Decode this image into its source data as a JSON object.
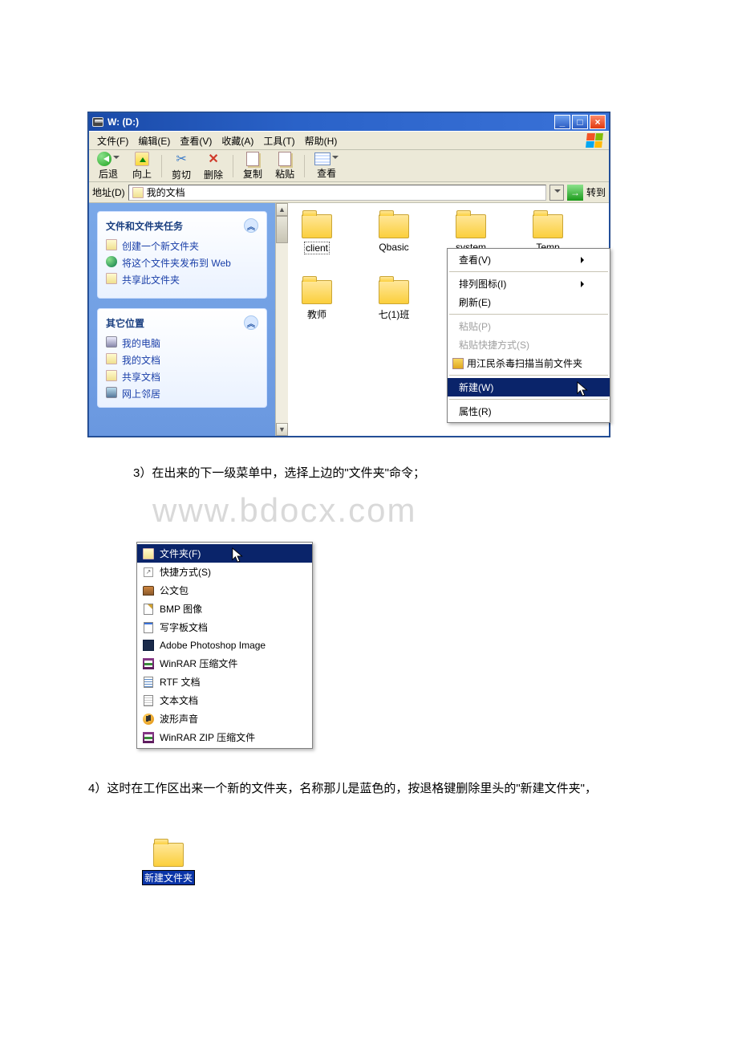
{
  "watermark": "www.bdocx.com",
  "window": {
    "title": "W: (D:)",
    "btn_min": "_",
    "btn_max": "□",
    "btn_close": "×"
  },
  "menubar": {
    "file": "文件(F)",
    "edit": "编辑(E)",
    "view": "查看(V)",
    "fav": "收藏(A)",
    "tools": "工具(T)",
    "help": "帮助(H)"
  },
  "toolbar": {
    "back": "后退",
    "up": "向上",
    "cut": "剪切",
    "del": "删除",
    "copy": "复制",
    "paste": "粘贴",
    "views": "查看"
  },
  "addressbar": {
    "label": "地址(D)",
    "value": "我的文档",
    "go": "转到"
  },
  "sidebar": {
    "tasks": {
      "title": "文件和文件夹任务",
      "items": [
        "创建一个新文件夹",
        "将这个文件夹发布到 Web",
        "共享此文件夹"
      ]
    },
    "other": {
      "title": "其它位置",
      "items": [
        "我的电脑",
        "我的文档",
        "共享文档",
        "网上邻居"
      ]
    }
  },
  "files": [
    "client",
    "Qbasic",
    "system",
    "Temp",
    "教师",
    "七(1)班"
  ],
  "contextmenu": {
    "view": "查看(V)",
    "arrange": "排列图标(I)",
    "refresh": "刷新(E)",
    "paste": "粘贴(P)",
    "paste_shortcut": "粘贴快捷方式(S)",
    "antivirus": "用江民杀毒扫描当前文件夹",
    "new": "新建(W)",
    "properties": "属性(R)"
  },
  "step3": "3）在出来的下一级菜单中，选择上边的\"文件夹\"命令；",
  "submenu": {
    "folder": "文件夹(F)",
    "shortcut": "快捷方式(S)",
    "briefcase": "公文包",
    "bmp": "BMP 图像",
    "wordpad": "写字板文档",
    "psd": "Adobe Photoshop Image",
    "winrar": "WinRAR 压缩文件",
    "rtf": "RTF 文档",
    "txt": "文本文档",
    "wav": "波形声音",
    "zip": "WinRAR ZIP 压缩文件"
  },
  "step4": "4）这时在工作区出来一个新的文件夹，名称那儿是蓝色的，按退格键删除里头的\"新建文件夹\"，",
  "newfolder_label": "新建文件夹"
}
